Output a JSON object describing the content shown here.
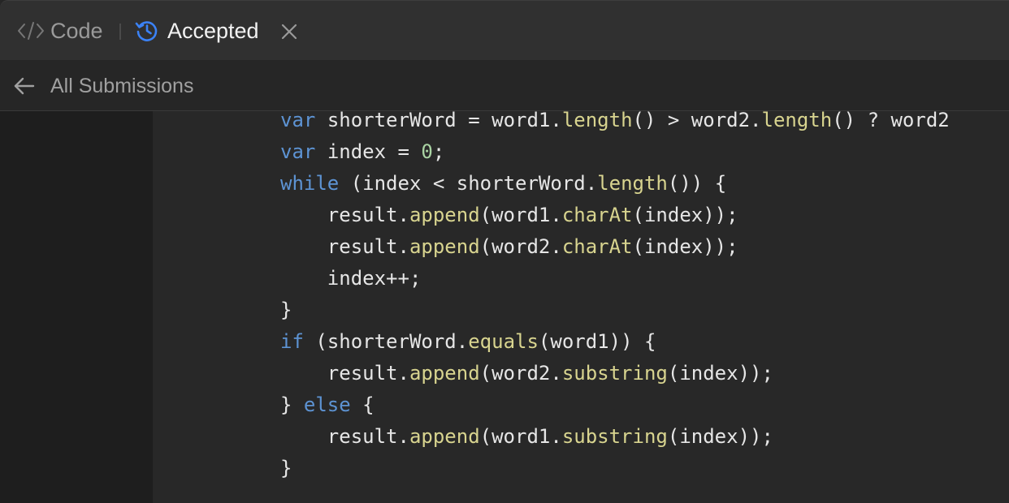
{
  "tabs": {
    "code_label": "Code",
    "accepted_label": "Accepted"
  },
  "icons": {
    "code": "code-brackets-icon",
    "accepted": "history-clock-icon",
    "close": "close-icon",
    "back": "arrow-left-icon"
  },
  "colors": {
    "accent_blue": "#3b82f6",
    "keyword": "#5d93d3",
    "function": "#d8d48f",
    "number": "#a9d3a3",
    "text": "#e6e6e6"
  },
  "subheader": {
    "back_label": "All Submissions"
  },
  "code": {
    "lines": [
      "var shorterWord = word1.length() > word2.length() ? word2",
      "var index = 0;",
      "while (index < shorterWord.length()) {",
      "    result.append(word1.charAt(index));",
      "    result.append(word2.charAt(index));",
      "    index++;",
      "}",
      "if (shorterWord.equals(word1)) {",
      "    result.append(word2.substring(index));",
      "} else {",
      "    result.append(word1.substring(index));",
      "}"
    ]
  }
}
